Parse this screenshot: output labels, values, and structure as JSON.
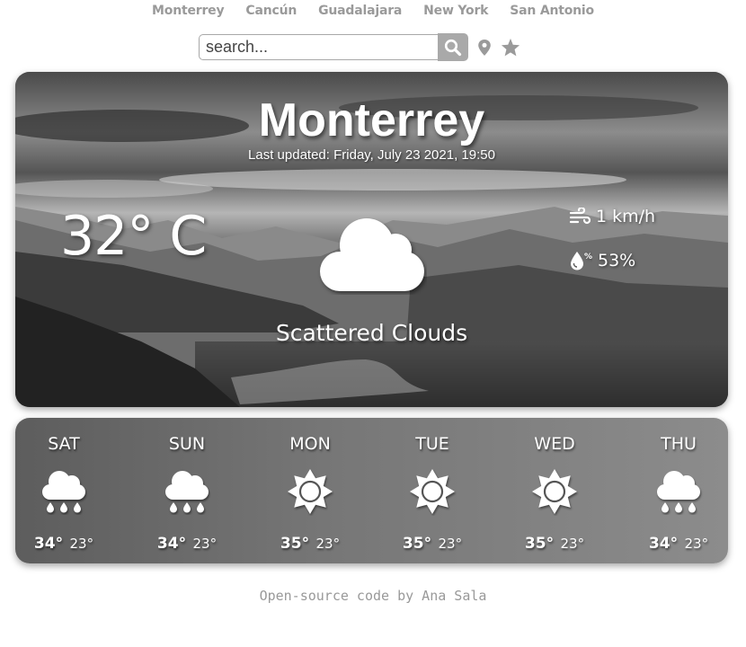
{
  "nav": {
    "cities": [
      "Monterrey",
      "Cancún",
      "Guadalajara",
      "New York",
      "San Antonio"
    ]
  },
  "search": {
    "placeholder": "search...",
    "value": "",
    "search_icon": "magnifier-icon",
    "location_icon": "map-pin-icon",
    "favorite_icon": "star-icon"
  },
  "current": {
    "city": "Monterrey",
    "last_updated": "Last updated: Friday, July 23 2021, 19:50",
    "temperature": "32° C",
    "condition": "Scattered Clouds",
    "condition_icon": "cloud-icon",
    "wind": "1 km/h",
    "wind_icon": "wind-icon",
    "humidity": "53%",
    "humidity_icon": "humidity-drop-icon"
  },
  "forecast": [
    {
      "day": "SAT",
      "icon": "rain",
      "high": "34°",
      "low": "23°"
    },
    {
      "day": "SUN",
      "icon": "rain",
      "high": "34°",
      "low": "23°"
    },
    {
      "day": "MON",
      "icon": "sun",
      "high": "35°",
      "low": "23°"
    },
    {
      "day": "TUE",
      "icon": "sun",
      "high": "35°",
      "low": "23°"
    },
    {
      "day": "WED",
      "icon": "sun",
      "high": "35°",
      "low": "23°"
    },
    {
      "day": "THU",
      "icon": "rain",
      "high": "34°",
      "low": "23°"
    }
  ],
  "footer": {
    "text": "Open-source code by Ana Sala"
  },
  "colors": {
    "nav_text": "#9a9a9a",
    "search_button": "#a9a9a9",
    "icon_gray": "#9a9a9a",
    "footer_text": "#999999"
  }
}
